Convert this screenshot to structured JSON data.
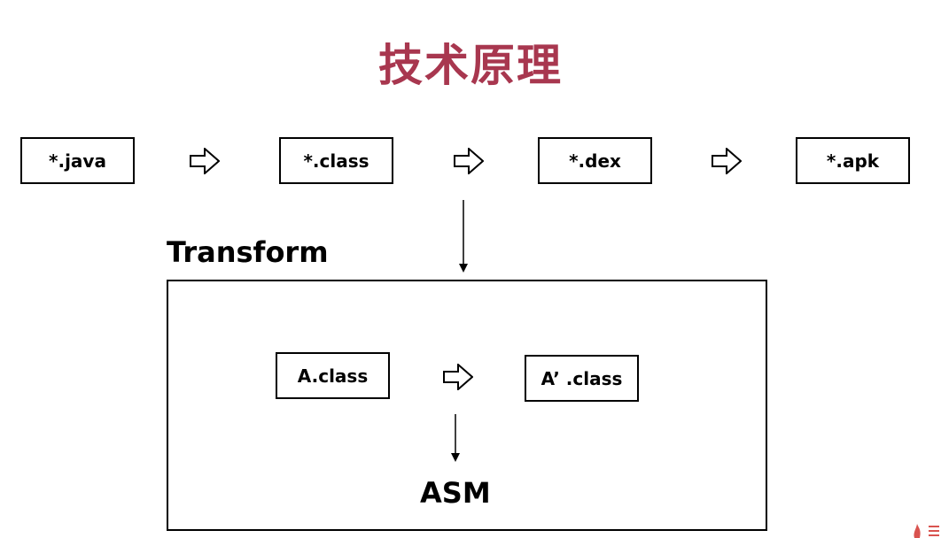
{
  "title": "技术原理",
  "pipeline": {
    "steps": [
      "*.java",
      "*.class",
      "*.dex",
      "*.apk"
    ]
  },
  "transform": {
    "label": "Transform",
    "input": "A.class",
    "output": "A’ .class",
    "tool": "ASM"
  },
  "colors": {
    "title": "#a8374f",
    "corner_logo": "#d9534f"
  },
  "icons": {
    "step_arrow": "hollow-right-arrow-icon",
    "flow_arrow": "down-arrow-icon"
  }
}
